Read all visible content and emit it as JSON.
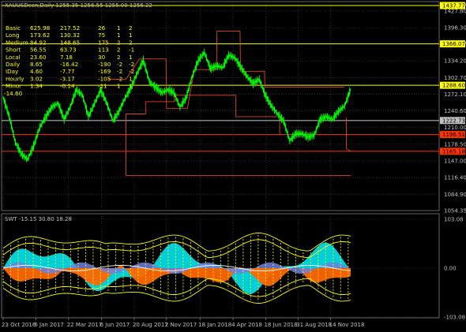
{
  "header": {
    "symbol_line": "XAUUSDecn,Daily 1255.35 1256.55 1255.00 1256.22"
  },
  "info_table": [
    {
      "label": "Basic",
      "v1": "625.98",
      "v2": "217.52",
      "v3": "26",
      "v4": "1",
      "v5": "2"
    },
    {
      "label": "Long",
      "v1": "173.62",
      "v2": "130.32",
      "v3": "75",
      "v4": "1",
      "v5": "1"
    },
    {
      "label": "Medium",
      "v1": "84.92",
      "v2": "148.65",
      "v3": "175",
      "v4": "2",
      "v5": "2"
    },
    {
      "label": "Short",
      "v1": "56.55",
      "v2": "63.73",
      "v3": "113",
      "v4": "2",
      "v5": "-1"
    },
    {
      "label": "Local",
      "v1": "23.60",
      "v2": "7.18",
      "v3": "30",
      "v4": "2",
      "v5": "1"
    },
    {
      "label": "Daily",
      "v1": "8.65",
      "v2": "-16.42",
      "v3": "-190",
      "v4": "-2",
      "v5": "-2"
    },
    {
      "label": "IDay",
      "v1": "4.60",
      "v2": "-7.77",
      "v3": "-169",
      "v4": "-2",
      "v5": "-2"
    },
    {
      "label": "Hourly",
      "v1": "3.02",
      "v2": "-3.17",
      "v3": "-105",
      "v4": "-2",
      "v5": "1"
    },
    {
      "label": "Minor",
      "v1": "1.34",
      "v2": "-0.14",
      "v3": "-11",
      "v4": "1",
      "v5": "1"
    }
  ],
  "extra_label": "-14.60",
  "chart_data": [
    {
      "type": "line",
      "title": "XAUUSDecn,Daily",
      "series_color": "#00ff00",
      "ylim": [
        1054.35,
        1437.77
      ],
      "y_ticks": [
        1054.35,
        1084.9,
        1116.4,
        1147.0,
        1178.5,
        1210.0,
        1240.6,
        1272.1,
        1302.7,
        1334.2,
        1366.07,
        1396.3,
        1427.8,
        1437.77
      ],
      "y_tick_labels": [
        "1054.35",
        "1084.90",
        "1116.40",
        "1147.00",
        "1178.50",
        "1210.00",
        "1240.60",
        "1272.10",
        "1302.70",
        "1334.20",
        "1366.07",
        "1396.30",
        "1427.80",
        "1437.77"
      ],
      "x_labels": [
        "23 Oct 2016",
        "6 Jan 2017",
        "22 Mar 2017",
        "6 Jun 2017",
        "20 Aug 2017",
        "2 Nov 2017",
        "18 Jan 2018",
        "4 Apr 2018",
        "18 Jun 2018",
        "31 Aug 2018",
        "14 Nov 2018"
      ],
      "x_dates": [
        "2016-10-23",
        "2016-11-06",
        "2016-11-20",
        "2016-12-04",
        "2016-12-18",
        "2017-01-01",
        "2017-01-15",
        "2017-01-29",
        "2017-02-12",
        "2017-02-26",
        "2017-03-12",
        "2017-03-26",
        "2017-04-09",
        "2017-04-23",
        "2017-05-07",
        "2017-05-21",
        "2017-06-04",
        "2017-06-18",
        "2017-07-02",
        "2017-07-16",
        "2017-07-30",
        "2017-08-13",
        "2017-08-27",
        "2017-09-10",
        "2017-09-24",
        "2017-10-08",
        "2017-10-22",
        "2017-11-05",
        "2017-11-19",
        "2017-12-03",
        "2017-12-17",
        "2017-12-31",
        "2018-01-14",
        "2018-01-28",
        "2018-02-11",
        "2018-02-25",
        "2018-03-11",
        "2018-03-25",
        "2018-04-08",
        "2018-04-22",
        "2018-05-06",
        "2018-05-20",
        "2018-06-03",
        "2018-06-17",
        "2018-07-01",
        "2018-07-15",
        "2018-07-29",
        "2018-08-12",
        "2018-08-26",
        "2018-09-09",
        "2018-09-23",
        "2018-10-07",
        "2018-10-21",
        "2018-11-04",
        "2018-11-18",
        "2018-12-02",
        "2018-12-16",
        "2018-12-30"
      ],
      "close": [
        1266,
        1230,
        1182,
        1160,
        1150,
        1175,
        1210,
        1230,
        1248,
        1255,
        1225,
        1248,
        1280,
        1270,
        1230,
        1255,
        1280,
        1255,
        1222,
        1240,
        1265,
        1285,
        1312,
        1335,
        1295,
        1285,
        1275,
        1280,
        1275,
        1248,
        1265,
        1305,
        1335,
        1350,
        1320,
        1325,
        1322,
        1345,
        1340,
        1322,
        1305,
        1292,
        1300,
        1270,
        1250,
        1235,
        1222,
        1185,
        1198,
        1198,
        1192,
        1195,
        1225,
        1230,
        1225,
        1240,
        1250,
        1282
      ],
      "levels": [
        {
          "value": 1437.77,
          "color": "#ffff00"
        },
        {
          "value": 1366.07,
          "color": "#ffff00"
        },
        {
          "value": 1288.6,
          "color": "#ffff00"
        },
        {
          "value": 1222.73,
          "color": "#cccccc"
        },
        {
          "value": 1196.51,
          "color": "#ff3300"
        },
        {
          "value": 1165.18,
          "color": "#ff3300"
        }
      ],
      "level_labels": [
        {
          "text": "1437.77",
          "value": 1437.77,
          "bg": "#ffff00",
          "fg": "#000000"
        },
        {
          "text": "1366.07",
          "value": 1366.07,
          "bg": "#ffff00",
          "fg": "#000000"
        },
        {
          "text": "1288.60",
          "value": 1288.6,
          "bg": "#ffff00",
          "fg": "#000000"
        },
        {
          "text": "1222.73",
          "value": 1222.73,
          "bg": "#c0c0c0",
          "fg": "#000000"
        },
        {
          "text": "1196.51",
          "value": 1196.51,
          "bg": "#ff3300",
          "fg": "#000000"
        },
        {
          "text": "1165.18",
          "value": 1165.18,
          "bg": "#ff3300",
          "fg": "#000000"
        }
      ]
    },
    {
      "type": "area",
      "title": "SWT -15.15 30.80 18.28",
      "ylim": [
        -103.08,
        103.08
      ],
      "y_tick_labels": [
        "103.08",
        "0.00",
        "-103.08"
      ],
      "colors": {
        "cyan": "#00e5ee",
        "orange": "#ff6600",
        "blue": "#6f7fe0",
        "yellow": "#ffff00"
      }
    }
  ]
}
